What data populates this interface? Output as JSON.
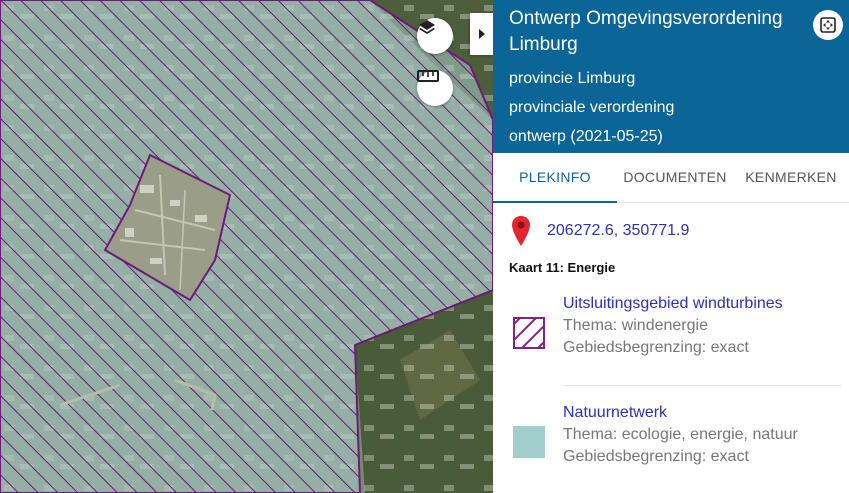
{
  "map": {
    "layers_icon": "layers-icon",
    "measure_icon": "ruler-icon",
    "toggle_icon": "chevron-right-icon",
    "colors": {
      "hatch": "#6e1a7a",
      "aerial_base": "#7b8876",
      "forest": "#4d5e3c",
      "overlay": "#a9cfc9"
    }
  },
  "panel": {
    "title": "Ontwerp Omgevingsverordening Limburg",
    "meta": [
      "provincie Limburg",
      "provinciale verordening",
      "ontwerp (2021-05-25)"
    ],
    "fullscreen_icon": "fullscreen-icon",
    "header_color": "#0b6596",
    "tabs": [
      {
        "label": "PLEKINFO",
        "active": true
      },
      {
        "label": "DOCUMENTEN",
        "active": false
      },
      {
        "label": "KENMERKEN",
        "active": false
      }
    ],
    "location": {
      "icon": "map-pin-icon",
      "coordinates": "206272.6, 350771.9"
    },
    "map_label": "Kaart 11: Energie",
    "items": [
      {
        "name": "Uitsluitingsgebied windturbines",
        "thema": "Thema: windenergie",
        "begrenzing": "Gebiedsbegrenzing: exact",
        "swatch": "hatch-swatch",
        "color": "#8a1f8a"
      },
      {
        "name": "Natuurnetwerk",
        "thema": "Thema: ecologie, energie, natuur",
        "begrenzing": "Gebiedsbegrenzing: exact",
        "swatch": "fill-swatch",
        "color": "#9fcecc"
      }
    ]
  }
}
